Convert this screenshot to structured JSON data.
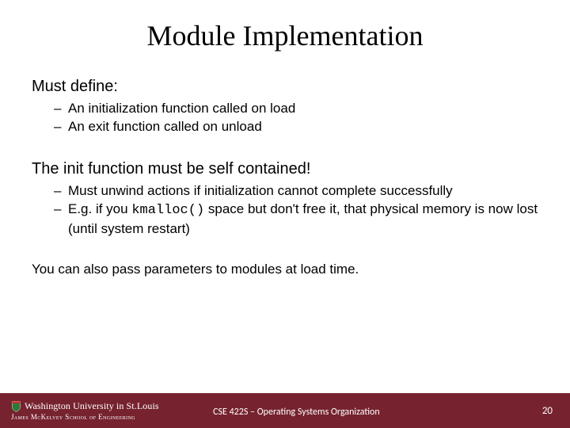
{
  "title": "Module Implementation",
  "section1": {
    "heading": "Must define:",
    "bullets": [
      "An initialization function called on load",
      "An exit function called on unload"
    ]
  },
  "section2": {
    "heading": "The init function must be self contained!",
    "bullets": [
      "Must unwind actions if initialization cannot complete successfully",
      {
        "pre": "E.g. if you ",
        "code": "kmalloc()",
        "post": " space but don't free it, that physical memory is now lost (until system restart)"
      }
    ]
  },
  "closing": "You can also pass parameters to modules at load time.",
  "footer": {
    "university": "Washington University in St.Louis",
    "school_pre": "James ",
    "school_mid": "McKelvey",
    "school_post": " School of Engineering",
    "course": "CSE 422S – Operating Systems Organization",
    "page": "20"
  }
}
